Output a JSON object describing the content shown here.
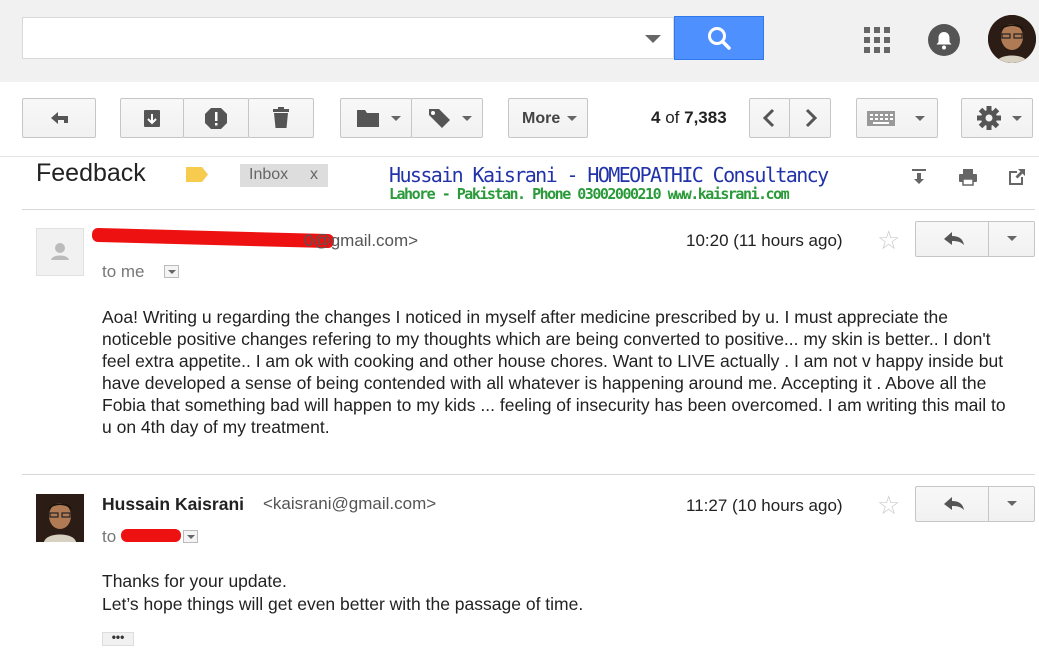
{
  "search": {
    "placeholder": ""
  },
  "toolbar": {
    "more_label": "More",
    "count_current": "4",
    "count_of": "of",
    "count_total": "7,383"
  },
  "thread": {
    "subject": "Feedback",
    "label": "Inbox",
    "label_remove": "x",
    "promo_line1": "Hussain Kaisrani - HOMEOPATHIC Consultancy",
    "promo_line2": "Lahore - Pakistan. Phone 03002000210 www.kaisrani.com"
  },
  "messages": [
    {
      "from_email_visible": "0@gmail.com>",
      "time": "10:20 (11 hours ago)",
      "to": "to me",
      "body": "Aoa! Writing u regarding the changes I noticed in myself after medicine prescribed by u. I must appreciate the noticeble positive changes refering to my thoughts which are being converted to positive... my skin is better.. I don't feel extra appetite.. I am ok with cooking and other house chores. Want to LIVE actually . I am not v happy inside but have developed a sense of being contended with all whatever is happening around me. Accepting it . Above all the Fobia that something bad will happen to my kids ... feeling of insecurity has been overcomed. I am writing this mail to u on 4th day of my treatment."
    },
    {
      "from_name": "Hussain Kaisrani",
      "from_email": "<kaisrani@gmail.com>",
      "time": "11:27 (10 hours ago)",
      "to": "to",
      "body_line1": "Thanks for your update.",
      "body_line2": "Let’s hope things will get even better with the passage of time.",
      "ellipsis": "•••"
    }
  ],
  "colors": {
    "accent": "#4d90fe",
    "redaction": "#ee1111",
    "promo_blue": "#2233aa",
    "promo_green": "#2a9a3a"
  }
}
